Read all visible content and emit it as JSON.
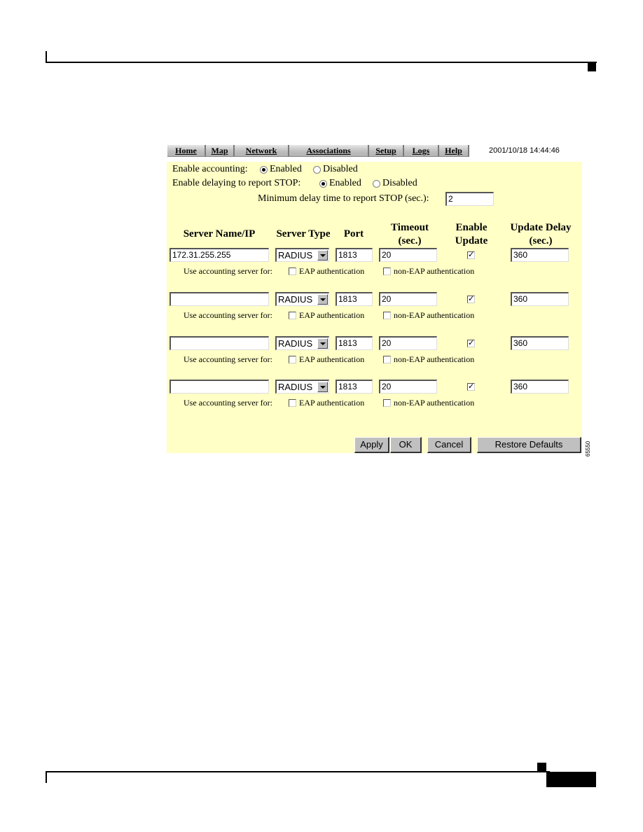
{
  "nav": {
    "tabs": [
      {
        "label": "Home"
      },
      {
        "label": "Map"
      },
      {
        "label": "Network"
      },
      {
        "label": "Associations"
      },
      {
        "label": "Setup"
      },
      {
        "label": "Logs"
      },
      {
        "label": "Help"
      }
    ],
    "timestamp": "2001/10/18 14:44:46"
  },
  "settings": {
    "enable_accounting": {
      "label": "Enable accounting:",
      "options": [
        "Enabled",
        "Disabled"
      ],
      "selected": "Enabled"
    },
    "enable_delaying": {
      "label": "Enable delaying to report STOP:",
      "options": [
        "Enabled",
        "Disabled"
      ],
      "selected": "Enabled"
    },
    "min_delay": {
      "label": "Minimum delay time to report STOP (sec.):",
      "value": "2"
    }
  },
  "columns": {
    "server": "Server Name/IP",
    "type": "Server Type",
    "port": "Port",
    "timeout_1": "Timeout",
    "timeout_2": "(sec.)",
    "enable_1": "Enable",
    "enable_2": "Update",
    "delay_1": "Update Delay",
    "delay_2": "(sec.)"
  },
  "servers": [
    {
      "name": "172.31.255.255",
      "type": "RADIUS",
      "port": "1813",
      "timeout": "20",
      "enable_update": true,
      "update_delay": "360",
      "use_label": "Use accounting server for:",
      "eap_label": "EAP authentication",
      "eap": false,
      "non_eap_label": "non-EAP authentication",
      "non_eap": false
    },
    {
      "name": "",
      "type": "RADIUS",
      "port": "1813",
      "timeout": "20",
      "enable_update": true,
      "update_delay": "360",
      "use_label": "Use accounting server for:",
      "eap_label": "EAP authentication",
      "eap": false,
      "non_eap_label": "non-EAP authentication",
      "non_eap": false
    },
    {
      "name": "",
      "type": "RADIUS",
      "port": "1813",
      "timeout": "20",
      "enable_update": true,
      "update_delay": "360",
      "use_label": "Use accounting server for:",
      "eap_label": "EAP authentication",
      "eap": false,
      "non_eap_label": "non-EAP authentication",
      "non_eap": false
    },
    {
      "name": "",
      "type": "RADIUS",
      "port": "1813",
      "timeout": "20",
      "enable_update": true,
      "update_delay": "360",
      "use_label": "Use accounting server for:",
      "eap_label": "EAP authentication",
      "eap": false,
      "non_eap_label": "non-EAP authentication",
      "non_eap": false
    }
  ],
  "buttons": {
    "apply": "Apply",
    "ok": "OK",
    "cancel": "Cancel",
    "restore": "Restore Defaults"
  },
  "figure_number": "65550"
}
